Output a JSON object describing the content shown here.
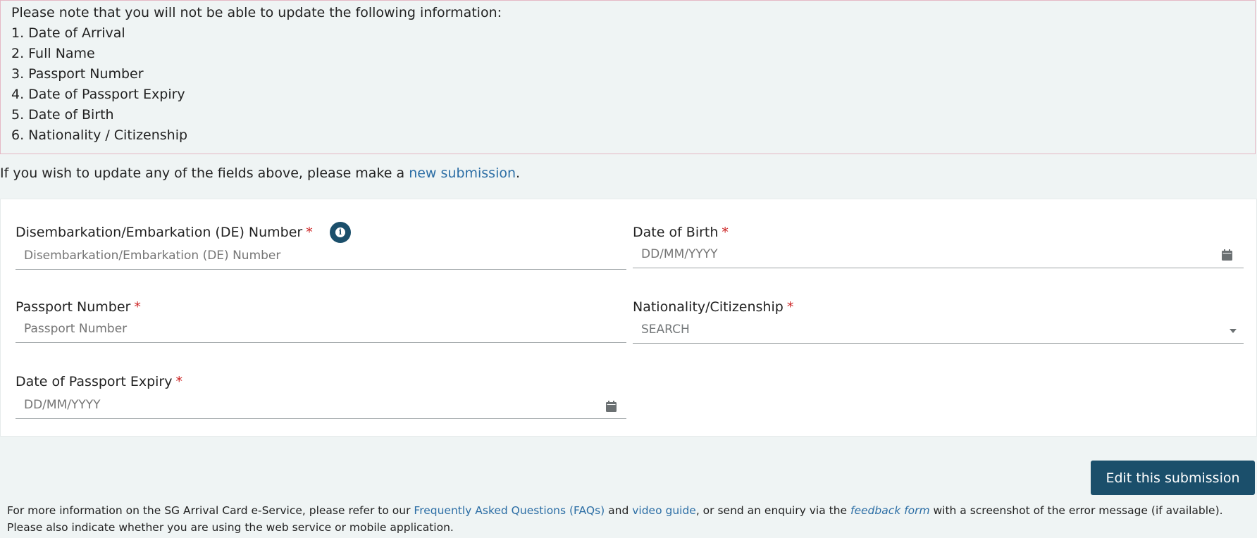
{
  "notice": {
    "intro": "Please note that you will not be able to update the following information:",
    "items": [
      "1. Date of Arrival",
      "2. Full Name",
      "3. Passport Number",
      "4. Date of Passport Expiry",
      "5. Date of Birth",
      "6. Nationality / Citizenship"
    ]
  },
  "update_line": {
    "prefix": "If you wish to update any of the fields above, please make a ",
    "link": "new submission",
    "suffix": "."
  },
  "form": {
    "de_number": {
      "label": "Disembarkation/Embarkation (DE) Number",
      "required": "*",
      "placeholder": "Disembarkation/Embarkation (DE) Number"
    },
    "dob": {
      "label": "Date of Birth",
      "required": "*",
      "placeholder": "DD/MM/YYYY"
    },
    "passport": {
      "label": "Passport Number",
      "required": "*",
      "placeholder": "Passport Number"
    },
    "nationality": {
      "label": "Nationality/Citizenship",
      "required": "*",
      "value": "SEARCH"
    },
    "passport_expiry": {
      "label": "Date of Passport Expiry",
      "required": "*",
      "placeholder": "DD/MM/YYYY"
    }
  },
  "submit_label": "Edit this submission",
  "footer": {
    "t1": "For more information on the SG Arrival Card e-Service, please refer to our ",
    "faq": "Frequently Asked Questions (FAQs)",
    "t2": " and ",
    "video": "video guide",
    "t3": ", or send an enquiry via the ",
    "feedback": "feedback form",
    "t4": " with a screenshot of the error message (if available).",
    "line2": "Please also indicate whether you are using the web service or mobile application."
  },
  "colors": {
    "accent": "#1b4f6b",
    "link": "#2c6ea5",
    "required": "#cc2222"
  },
  "icons": [
    "info-icon",
    "calendar-icon",
    "chevron-down-icon"
  ]
}
